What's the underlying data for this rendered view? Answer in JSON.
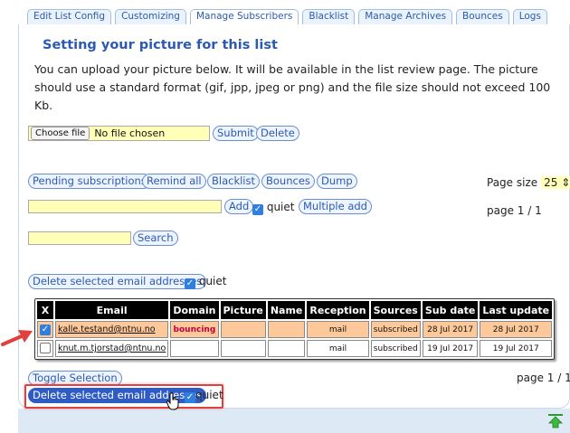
{
  "tabs": [
    "Edit List Config",
    "Customizing",
    "Manage Subscribers",
    "Blacklist",
    "Manage Archives",
    "Bounces",
    "Logs"
  ],
  "picture": {
    "title": "Setting your picture for this list",
    "intro": "You can upload your picture below. It will be available in the list review page. The picture should use a standard format (gif, jpp, jpeg or png) and the file size should not exceed 100 Kb.",
    "choose_file": "Choose file",
    "no_file": "No file chosen",
    "submit": "Submit",
    "delete": "Delete"
  },
  "actions": {
    "pending": "Pending subscriptions",
    "remind_all": "Remind all",
    "blacklist": "Blacklist",
    "bounces": "Bounces",
    "dump": "Dump",
    "add": "Add",
    "quiet": "quiet",
    "multiple_add": "Multiple add",
    "search": "Search",
    "delete_selected": "Delete selected email addresses",
    "toggle_selection": "Toggle Selection"
  },
  "paging": {
    "page_size_label": "Page size",
    "page_size_value": "25",
    "page_top": "page 1 / 1",
    "page_bottom": "page 1 / 1"
  },
  "table": {
    "headers": [
      "X",
      "Email",
      "Domain",
      "Picture",
      "Name",
      "Reception",
      "Sources",
      "Sub date",
      "Last update"
    ],
    "rows": [
      {
        "email": "kalle.testand@ntnu.no",
        "domain": "bouncing",
        "picture": "",
        "name": "",
        "reception": "mail",
        "sources": "subscribed",
        "sub_date": "28 Jul 2017",
        "last_update": "28 Jul 2017",
        "checked": true
      },
      {
        "email": "knut.m.tjorstad@ntnu.no",
        "domain": "",
        "picture": "",
        "name": "",
        "reception": "mail",
        "sources": "subscribed",
        "sub_date": "19 Jul 2017",
        "last_update": "19 Jul 2017",
        "checked": false
      }
    ]
  },
  "colors": {
    "accent": "#2b5ab0",
    "highlight_row": "#fdc89a",
    "bouncing": "#ffb0c8",
    "input_bg": "#ffffb8",
    "callout": "#e04040"
  }
}
